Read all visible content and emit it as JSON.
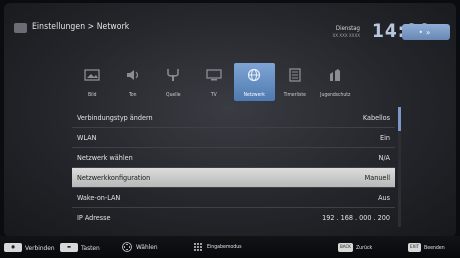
{
  "header": {
    "breadcrumb": "Einstellungen > Network",
    "date_day": "Dienstag",
    "date_sub": "XX XXX XXXX",
    "clock": "14:00"
  },
  "tabs": [
    {
      "label": "Bild",
      "icon": "picture-icon",
      "active": false
    },
    {
      "label": "Ton",
      "icon": "speaker-icon",
      "active": false
    },
    {
      "label": "Quelle",
      "icon": "source-icon",
      "active": false
    },
    {
      "label": "TV",
      "icon": "tv-icon",
      "active": false
    },
    {
      "label": "Netzwerk",
      "icon": "network-globe-icon",
      "active": true
    },
    {
      "label": "Timerliste",
      "icon": "timer-list-icon",
      "active": false
    },
    {
      "label": "Jugendschutz",
      "icon": "parental-control-icon",
      "active": false
    }
  ],
  "settings": [
    {
      "label": "Verbindungstyp ändern",
      "value": "Kabellos",
      "selected": false
    },
    {
      "label": "WLAN",
      "value": "Ein",
      "selected": false
    },
    {
      "label": "Netzwerk wählen",
      "value": "N/A",
      "selected": false
    },
    {
      "label": "Netzwerkkonfiguration",
      "value": "Manuell",
      "selected": true
    },
    {
      "label": "Wake-on-LAN",
      "value": "Aus",
      "selected": false
    },
    {
      "label": "IP Adresse",
      "value": "192 . 168 . 000 . 200",
      "selected": false
    }
  ],
  "legend": {
    "verbinden": "Verbinden",
    "tasten": "Tasten",
    "waehlen": "Wählen",
    "eingabemodus": "Eingabemodus",
    "back_key": "BACK",
    "zurueck": "Zurück",
    "exit_key": "EXIT",
    "beenden": "Beenden"
  },
  "colors": {
    "accent_blue": "#5a83b9",
    "selected_row": "#c8c8c8",
    "clock": "#b7c5dd"
  }
}
